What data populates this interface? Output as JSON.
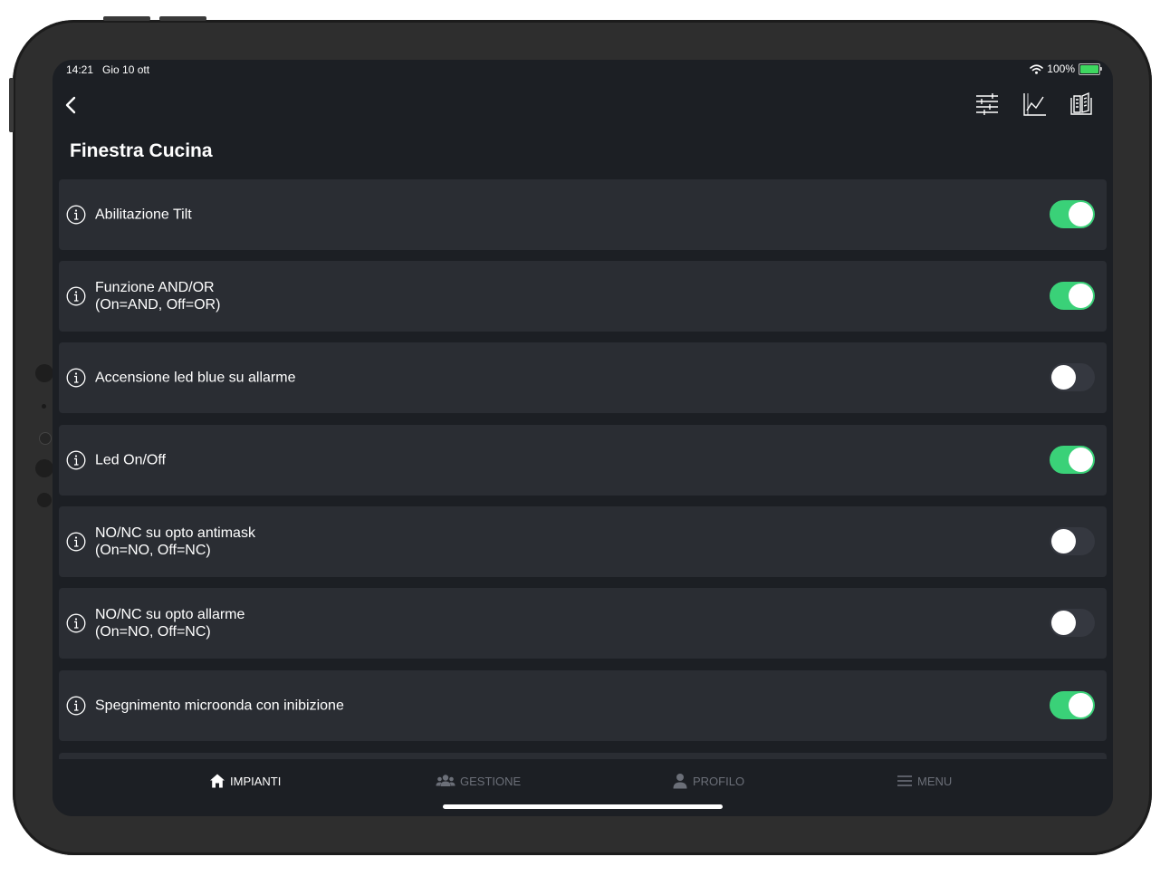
{
  "status_bar": {
    "time": "14:21",
    "date": "Gio 10 ott",
    "battery_percent": "100%"
  },
  "nav": {
    "icons": [
      "sliders-icon",
      "chart-line-icon",
      "book-icon"
    ]
  },
  "page": {
    "title": "Finestra Cucina"
  },
  "settings": [
    {
      "line1": "Abilitazione Tilt",
      "line2": "",
      "enabled": true
    },
    {
      "line1": "Funzione AND/OR",
      "line2": "(On=AND, Off=OR)",
      "enabled": true
    },
    {
      "line1": "Accensione led blue su allarme",
      "line2": "",
      "enabled": false
    },
    {
      "line1": "Led On/Off",
      "line2": "",
      "enabled": true
    },
    {
      "line1": "NO/NC su opto antimask",
      "line2": "(On=NO, Off=NC)",
      "enabled": false
    },
    {
      "line1": "NO/NC su opto allarme",
      "line2": "(On=NO, Off=NC)",
      "enabled": false
    },
    {
      "line1": "Spegnimento microonda con inibizione",
      "line2": "",
      "enabled": true
    }
  ],
  "tabs": [
    {
      "label": "IMPIANTI",
      "icon": "home-icon",
      "active": true
    },
    {
      "label": "GESTIONE",
      "icon": "users-icon",
      "active": false
    },
    {
      "label": "PROFILO",
      "icon": "user-icon",
      "active": false
    },
    {
      "label": "MENU",
      "icon": "menu-icon",
      "active": false
    }
  ],
  "colors": {
    "toggle_on": "#3ad178",
    "toggle_off": "#353840",
    "row_background": "#2a2d33",
    "screen_background": "#1c1f24",
    "tab_inactive": "#6b6f78"
  }
}
